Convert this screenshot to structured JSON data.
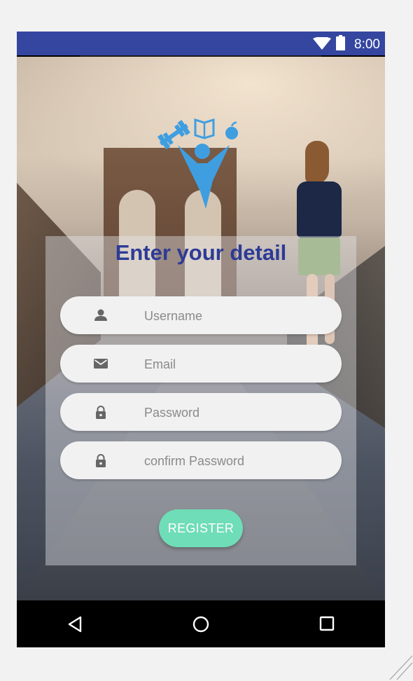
{
  "status_bar": {
    "time": "8:00"
  },
  "form": {
    "title": "Enter your detail",
    "fields": [
      {
        "placeholder": "Username",
        "icon": "person-icon"
      },
      {
        "placeholder": "Email",
        "icon": "email-icon"
      },
      {
        "placeholder": "Password",
        "icon": "lock-icon"
      },
      {
        "placeholder": "confirm Password",
        "icon": "lock-icon"
      }
    ],
    "register_label": "REGISTER"
  },
  "colors": {
    "status_bar": "#3546a0",
    "title": "#2d3b96",
    "register_button": "#6fddb7",
    "logo": "#3f9ee0"
  },
  "nav_bar": {
    "icons": [
      "back-icon",
      "home-icon",
      "recents-icon"
    ]
  }
}
